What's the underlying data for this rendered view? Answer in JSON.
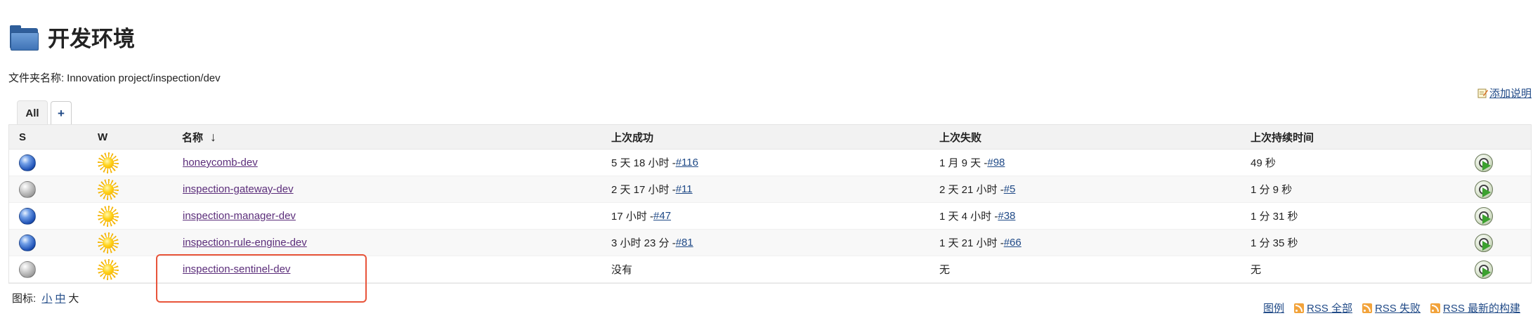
{
  "page": {
    "title": "开发环境",
    "folder_label": "文件夹名称:",
    "folder_path": "Innovation project/inspection/dev",
    "add_description": "添加说明"
  },
  "tabs": {
    "all": "All",
    "add": "+"
  },
  "table": {
    "headers": {
      "s": "S",
      "w": "W",
      "name": "名称",
      "sort_arrow": "↓",
      "last_success": "上次成功",
      "last_failure": "上次失败",
      "last_duration": "上次持续时间"
    },
    "rows": [
      {
        "status": "blue",
        "name": "honeycomb-dev",
        "succ_text": "5 天 18 小时 - ",
        "succ_build": "#116",
        "fail_text": "1 月 9 天 - ",
        "fail_build": "#98",
        "duration": "49 秒"
      },
      {
        "status": "grey",
        "name": "inspection-gateway-dev",
        "succ_text": "2 天 17 小时 - ",
        "succ_build": "#11",
        "fail_text": "2 天 21 小时 - ",
        "fail_build": "#5",
        "duration": "1 分 9 秒"
      },
      {
        "status": "blue",
        "name": "inspection-manager-dev",
        "succ_text": "17 小时 - ",
        "succ_build": "#47",
        "fail_text": "1 天 4 小时 - ",
        "fail_build": "#38",
        "duration": "1 分 31 秒"
      },
      {
        "status": "blue",
        "name": "inspection-rule-engine-dev",
        "succ_text": "3 小时 23 分 - ",
        "succ_build": "#81",
        "fail_text": "1 天 21 小时 - ",
        "fail_build": "#66",
        "duration": "1 分 35 秒"
      },
      {
        "status": "grey",
        "name": "inspection-sentinel-dev",
        "succ_text": "没有",
        "succ_build": "",
        "fail_text": "无",
        "fail_build": "",
        "duration": "无"
      }
    ]
  },
  "icon_size": {
    "label": "图标:",
    "small": "小",
    "medium": "中",
    "large": "大"
  },
  "footer": {
    "legend": "图例",
    "rss_all": "RSS 全部",
    "rss_failures": "RSS 失败",
    "rss_latest": "RSS 最新的构建"
  },
  "colors": {
    "link": "#204A87",
    "visited_link": "#5b2d7a",
    "highlight_border": "#e8543a",
    "header_bg": "#f2f2f2"
  }
}
